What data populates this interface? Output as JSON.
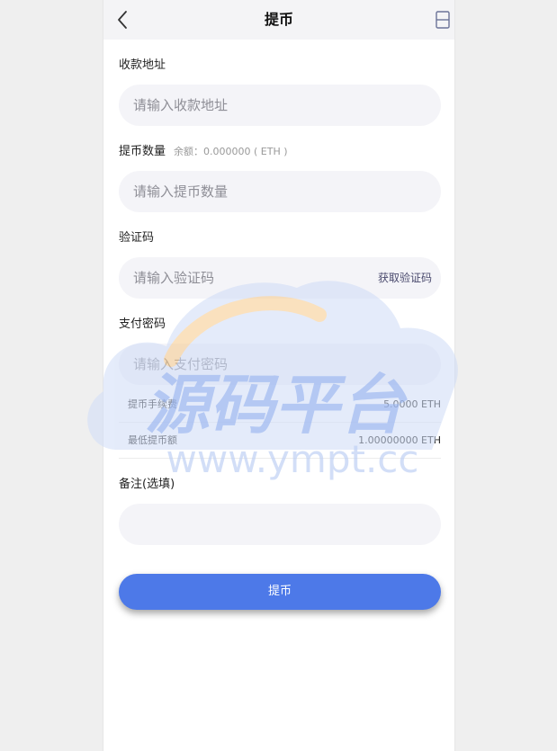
{
  "header": {
    "title": "提币"
  },
  "form": {
    "address_label": "收款地址",
    "address_placeholder": "请输入收款地址",
    "amount_label": "提币数量",
    "balance_text": "余额：0.000000 ( ETH )",
    "amount_placeholder": "请输入提币数量",
    "code_label": "验证码",
    "code_placeholder": "请输入验证码",
    "get_code_label": "获取验证码",
    "password_label": "支付密码",
    "password_placeholder": "请输入支付密码",
    "remark_label": "备注(选填)",
    "remark_placeholder": ""
  },
  "fees": [
    {
      "label": "提币手续费",
      "value": "5.0000 ETH"
    },
    {
      "label": "最低提币额",
      "value": "1.00000000 ETH"
    }
  ],
  "submit_label": "提币",
  "watermark": {
    "main": "源码平台",
    "url": "www.ympt.cc"
  },
  "colors": {
    "primary": "#4d79e8",
    "input_bg": "#f4f4f8",
    "page_bg": "#efefef",
    "header_bg": "#f4f4f6"
  }
}
